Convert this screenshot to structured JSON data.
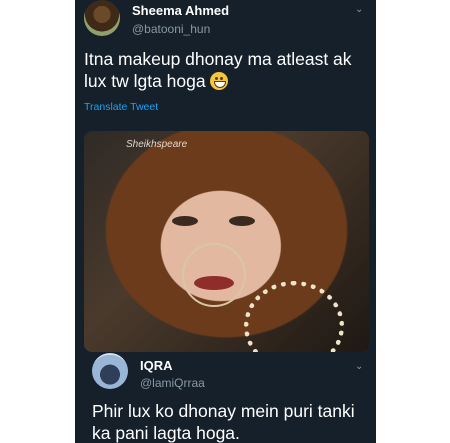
{
  "tweet": {
    "author_name": "Sheema Ahmed",
    "author_handle": "@batooni_hun",
    "text": "Itna makeup dhonay ma atleast ak lux tw lgta hoga",
    "emoji_icon": "grinning-face-emoji",
    "translate_label": "Translate Tweet",
    "media_watermark": "Sheikhspeare"
  },
  "reply": {
    "author_name": "IQRA",
    "author_handle": "@lamiQrraa",
    "text": "Phir lux ko dhonay mein puri tanki ka pani lagta hoga."
  },
  "colors": {
    "background": "#15202b",
    "primary_text": "#ffffff",
    "secondary_text": "#8899a6",
    "link": "#1da1f2"
  }
}
